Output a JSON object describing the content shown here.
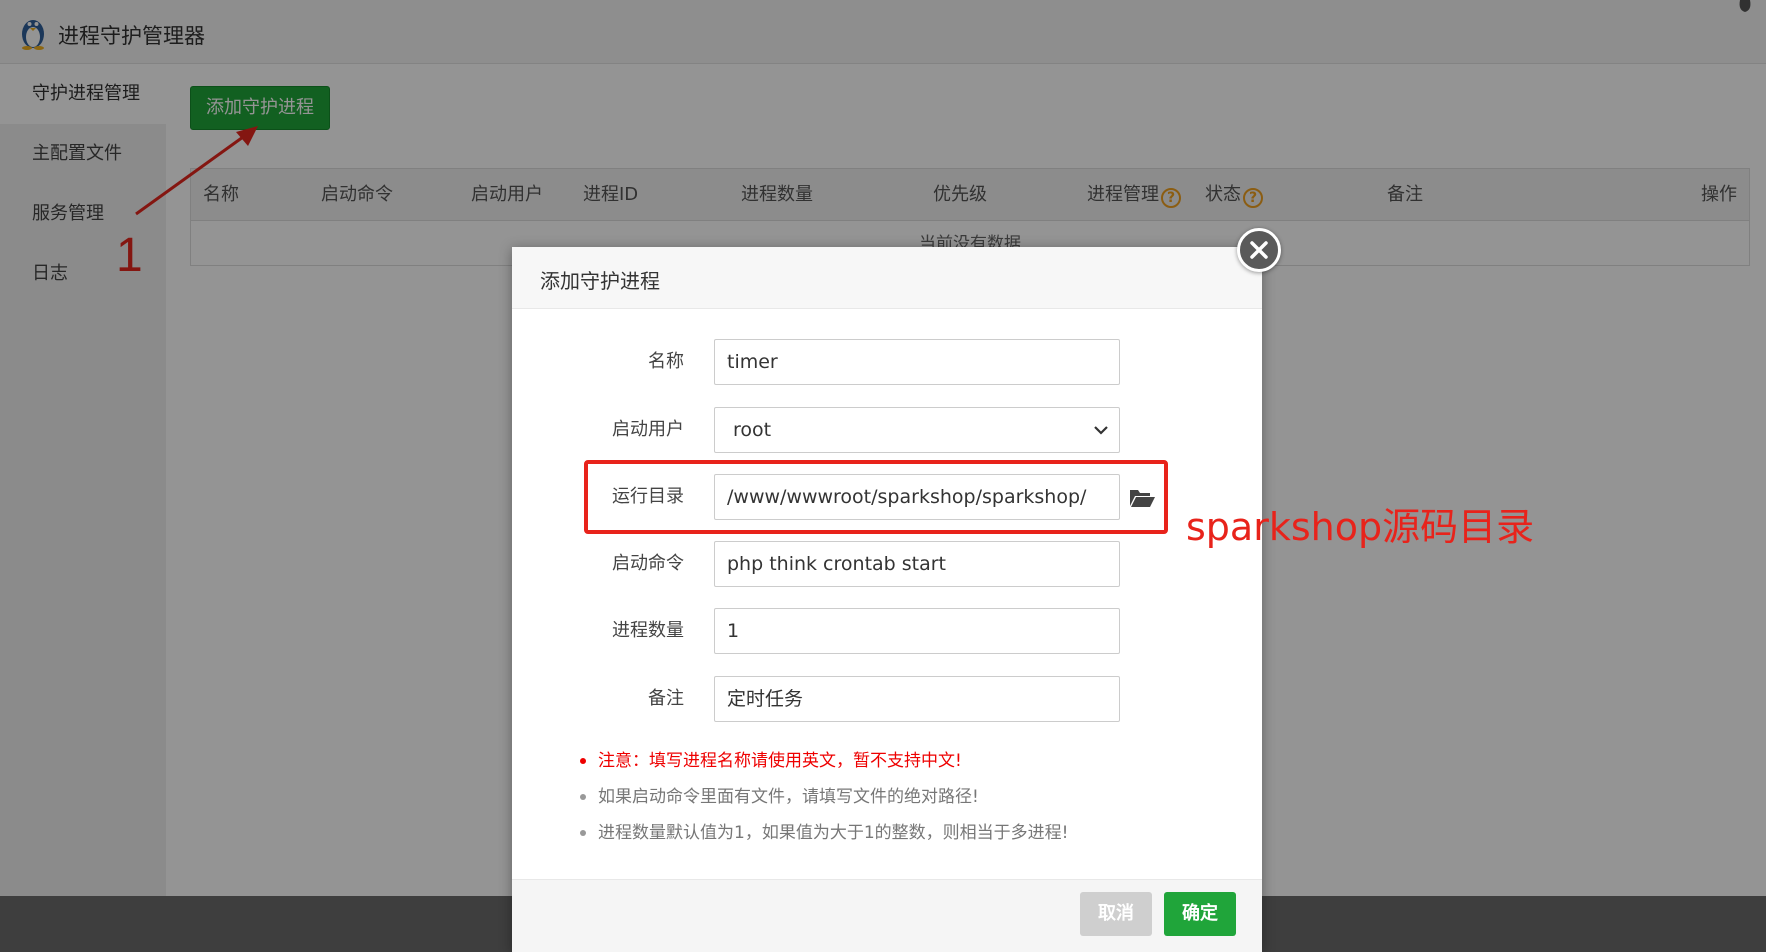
{
  "window": {
    "title": "进程守护管理器"
  },
  "sidebar": {
    "items": [
      {
        "label": "守护进程管理"
      },
      {
        "label": "主配置文件"
      },
      {
        "label": "服务管理"
      },
      {
        "label": "日志"
      }
    ]
  },
  "toolbar": {
    "add_label": "添加守护进程"
  },
  "table": {
    "columns": [
      "名称",
      "启动命令",
      "启动用户",
      "进程ID",
      "进程数量",
      "优先级",
      "进程管理",
      "状态",
      "备注",
      "操作"
    ],
    "help_icon": "?",
    "empty_text": "当前没有数据"
  },
  "annotations": {
    "step_number": "1",
    "highlight_note": "sparkshop源码目录"
  },
  "dialog": {
    "title": "添加守护进程",
    "fields": {
      "name": {
        "label": "名称",
        "value": "timer"
      },
      "user": {
        "label": "启动用户",
        "value": "root"
      },
      "dir": {
        "label": "运行目录",
        "value": "/www/wwwroot/sparkshop/sparkshop/"
      },
      "command": {
        "label": "启动命令",
        "value": "php think crontab start"
      },
      "count": {
        "label": "进程数量",
        "value": "1"
      },
      "remark": {
        "label": "备注",
        "value": "定时任务"
      }
    },
    "hints": [
      "注意：填写进程名称请使用英文，暂不支持中文!",
      "如果启动命令里面有文件，请填写文件的绝对路径!",
      "进程数量默认值为1，如果值为大于1的整数，则相当于多进程!"
    ],
    "cancel_label": "取消",
    "ok_label": "确定"
  },
  "colors": {
    "accent_green": "#20a53a",
    "annotation_red": "#e8231b",
    "help_orange": "#f0a020"
  },
  "icons": {
    "app": "penguin-icon",
    "folder": "folder-open-icon",
    "close": "close-icon",
    "chevron": "chevron-down-icon"
  }
}
